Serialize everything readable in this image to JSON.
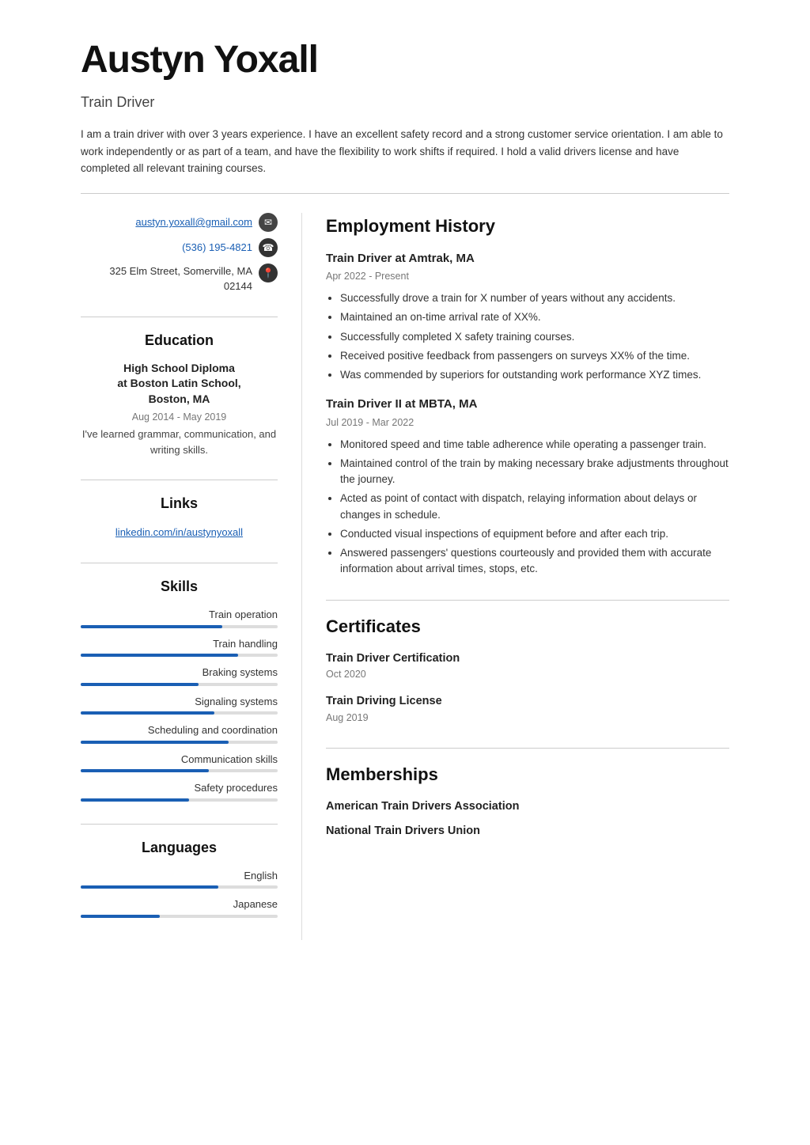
{
  "header": {
    "name": "Austyn Yoxall",
    "title": "Train Driver",
    "summary": "I am a train driver with over 3 years experience. I have an excellent safety record and a strong customer service orientation. I am able to work independently or as part of a team, and have the flexibility to work shifts if required. I hold a valid drivers license and have completed all relevant training courses."
  },
  "contact": {
    "email": "austyn.yoxall@gmail.com",
    "phone": "(536) 195-4821",
    "address_line1": "325 Elm Street, Somerville, MA",
    "address_line2": "02144"
  },
  "education": {
    "section_title": "Education",
    "items": [
      {
        "degree": "High School Diploma",
        "school": "at Boston Latin School, Boston, MA",
        "dates": "Aug 2014 - May 2019",
        "description": "I've learned grammar, communication, and writing skills."
      }
    ]
  },
  "links": {
    "section_title": "Links",
    "items": [
      {
        "label": "linkedin.com/in/austynyoxall",
        "url": "linkedin.com/in/austynyoxall"
      }
    ]
  },
  "skills": {
    "section_title": "Skills",
    "items": [
      {
        "label": "Train operation",
        "percent": 72
      },
      {
        "label": "Train handling",
        "percent": 80
      },
      {
        "label": "Braking systems",
        "percent": 60
      },
      {
        "label": "Signaling systems",
        "percent": 68
      },
      {
        "label": "Scheduling and coordination",
        "percent": 75
      },
      {
        "label": "Communication skills",
        "percent": 65
      },
      {
        "label": "Safety procedures",
        "percent": 55
      }
    ]
  },
  "languages": {
    "section_title": "Languages",
    "items": [
      {
        "label": "English",
        "percent": 70
      },
      {
        "label": "Japanese",
        "percent": 40
      }
    ]
  },
  "employment": {
    "section_title": "Employment History",
    "jobs": [
      {
        "title": "Train Driver at Amtrak, MA",
        "dates": "Apr 2022 - Present",
        "bullets": [
          "Successfully drove a train for X number of years without any accidents.",
          "Maintained an on-time arrival rate of XX%.",
          "Successfully completed X safety training courses.",
          "Received positive feedback from passengers on surveys XX% of the time.",
          "Was commended by superiors for outstanding work performance XYZ times."
        ]
      },
      {
        "title": "Train Driver II at MBTA, MA",
        "dates": "Jul 2019 - Mar 2022",
        "bullets": [
          "Monitored speed and time table adherence while operating a passenger train.",
          "Maintained control of the train by making necessary brake adjustments throughout the journey.",
          "Acted as point of contact with dispatch, relaying information about delays or changes in schedule.",
          "Conducted visual inspections of equipment before and after each trip.",
          "Answered passengers' questions courteously and provided them with accurate information about arrival times, stops, etc."
        ]
      }
    ]
  },
  "certificates": {
    "section_title": "Certificates",
    "items": [
      {
        "name": "Train Driver Certification",
        "date": "Oct 2020"
      },
      {
        "name": "Train Driving License",
        "date": "Aug 2019"
      }
    ]
  },
  "memberships": {
    "section_title": "Memberships",
    "items": [
      {
        "name": "American Train Drivers Association"
      },
      {
        "name": "National Train Drivers Union"
      }
    ]
  },
  "icons": {
    "email": "✉",
    "phone": "📞",
    "location": "📍"
  }
}
